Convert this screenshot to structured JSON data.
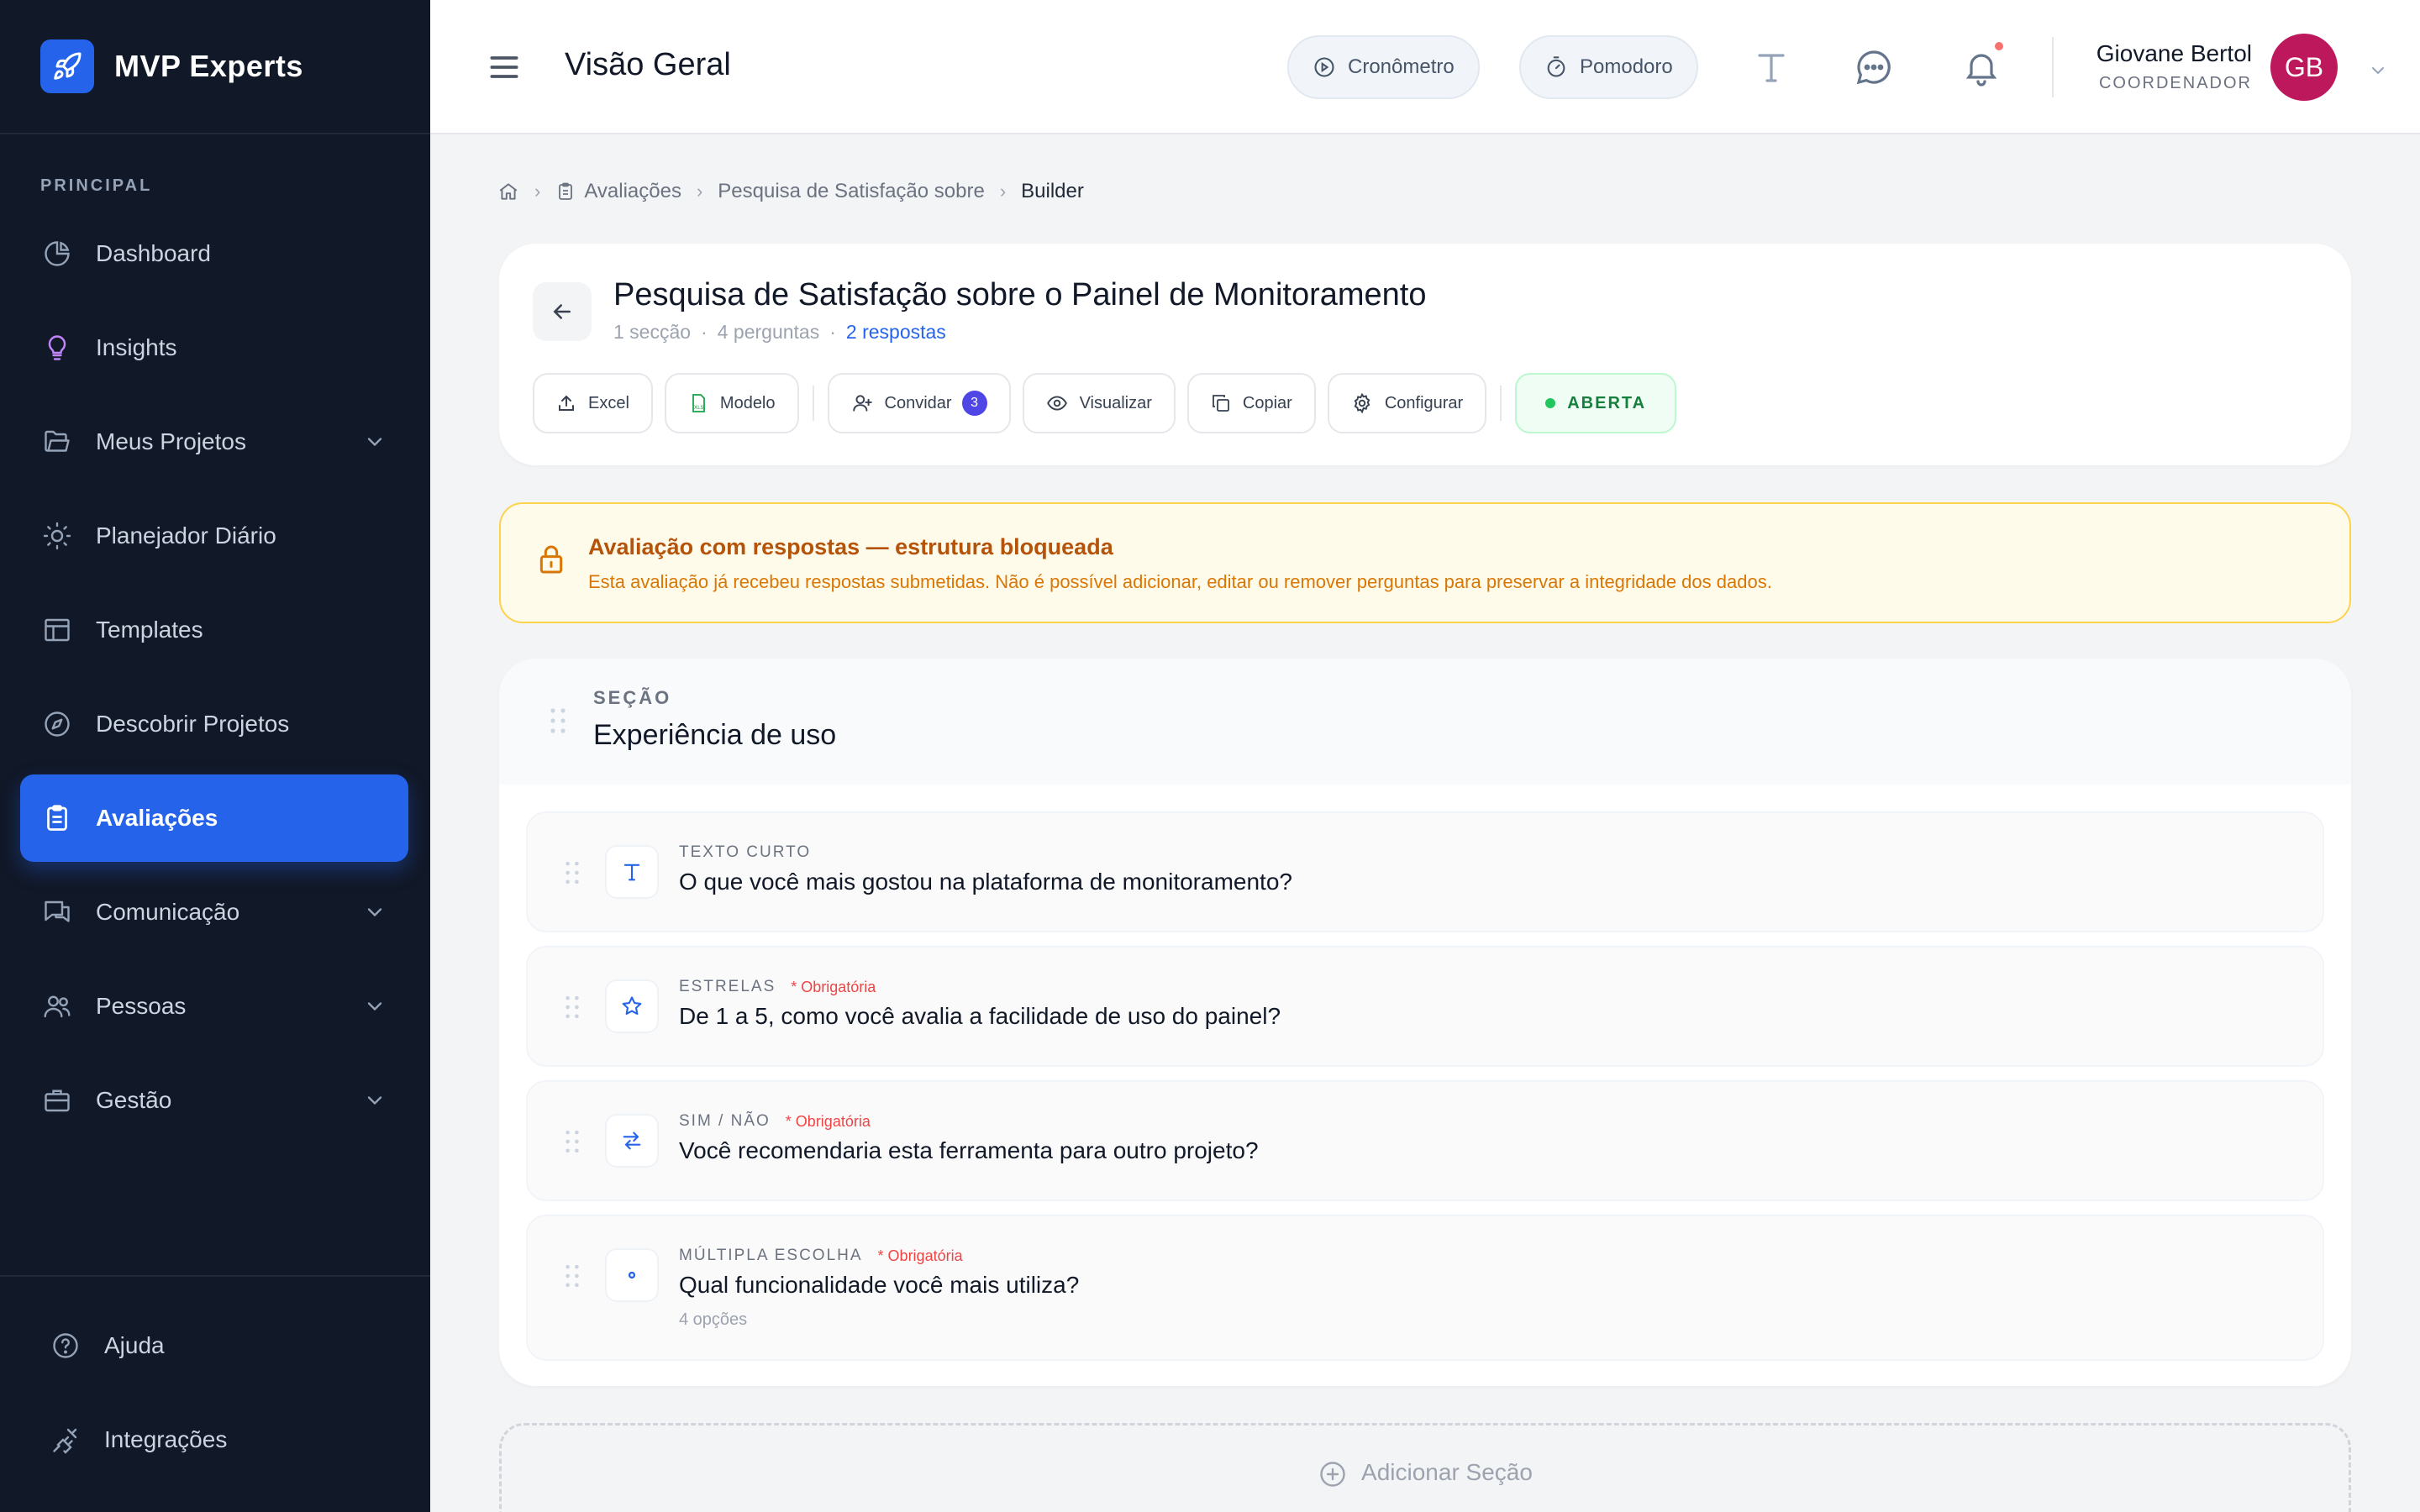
{
  "brand": {
    "name": "MVP Experts"
  },
  "sidebar": {
    "section_label": "PRINCIPAL",
    "items": [
      {
        "label": "Dashboard",
        "icon": "chart-pie-icon",
        "expandable": false,
        "active": false
      },
      {
        "label": "Insights",
        "icon": "lightbulb-icon",
        "expandable": false,
        "active": false
      },
      {
        "label": "Meus Projetos",
        "icon": "folder-icon",
        "expandable": true,
        "active": false
      },
      {
        "label": "Planejador Diário",
        "icon": "sun-icon",
        "expandable": false,
        "active": false
      },
      {
        "label": "Templates",
        "icon": "layout-icon",
        "expandable": false,
        "active": false
      },
      {
        "label": "Descobrir Projetos",
        "icon": "compass-icon",
        "expandable": false,
        "active": false
      },
      {
        "label": "Avaliações",
        "icon": "clipboard-icon",
        "expandable": false,
        "active": true
      },
      {
        "label": "Comunicação",
        "icon": "chat-icon",
        "expandable": true,
        "active": false
      },
      {
        "label": "Pessoas",
        "icon": "users-icon",
        "expandable": true,
        "active": false
      },
      {
        "label": "Gestão",
        "icon": "briefcase-icon",
        "expandable": true,
        "active": false
      }
    ],
    "bottom": [
      {
        "label": "Ajuda",
        "icon": "help-circle-icon"
      },
      {
        "label": "Integrações",
        "icon": "plug-icon"
      }
    ]
  },
  "header": {
    "title": "Visão Geral",
    "timer_label": "Cronômetro",
    "pomodoro_label": "Pomodoro",
    "user": {
      "name": "Giovane Bertol",
      "role": "COORDENADOR",
      "initials": "GB"
    }
  },
  "breadcrumb": {
    "items": [
      "Avaliações",
      "Pesquisa de Satisfação sobre",
      "Builder"
    ]
  },
  "evaluation": {
    "title": "Pesquisa de Satisfação sobre o Painel de Monitoramento",
    "sections_count": "1 secção",
    "questions_count": "4 perguntas",
    "responses_count": "2 respostas",
    "toolbar": {
      "excel": "Excel",
      "modelo": "Modelo",
      "convidar": "Convidar",
      "convidar_badge": "3",
      "visualizar": "Visualizar",
      "copiar": "Copiar",
      "configurar": "Configurar",
      "status": "ABERTA"
    }
  },
  "warning": {
    "title": "Avaliação com respostas — estrutura bloqueada",
    "text": "Esta avaliação já recebeu respostas submetidas. Não é possível adicionar, editar ou remover perguntas para preservar a integridade dos dados."
  },
  "section": {
    "kicker": "SEÇÃO",
    "title": "Experiência de uso",
    "questions": [
      {
        "type": "TEXTO CURTO",
        "required": "",
        "text": "O que você mais gostou na plataforma de monitoramento?",
        "sub": ""
      },
      {
        "type": "ESTRELAS",
        "required": "* Obrigatória",
        "text": "De 1 a 5, como você avalia a facilidade de uso do painel?",
        "sub": ""
      },
      {
        "type": "SIM / NÃO",
        "required": "* Obrigatória",
        "text": "Você recomendaria esta ferramenta para outro projeto?",
        "sub": ""
      },
      {
        "type": "MÚLTIPLA ESCOLHA",
        "required": "* Obrigatória",
        "text": "Qual funcionalidade você mais utiliza?",
        "sub": "4 opções"
      }
    ]
  },
  "add_section": {
    "label": "Adicionar Seção"
  },
  "colors": {
    "sidebar_bg": "#111827",
    "accent": "#2563eb",
    "status_green": "#15803d",
    "warning_text": "#b45309",
    "avatar": "#be185d"
  }
}
